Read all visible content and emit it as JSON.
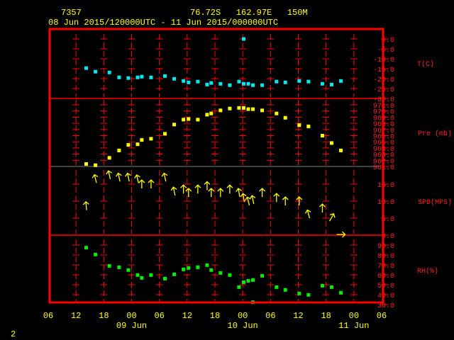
{
  "header": {
    "station_id": "7357",
    "location": "76.72S   162.97E   150M",
    "period": "08 Jun 2015/120000UTC - 11 Jun 2015/000000UTC"
  },
  "page_number": "2",
  "colors": {
    "frame": "#ff0000",
    "text": "#ffff00",
    "temp": "#00e8f0",
    "pressure": "#ffff00",
    "wind": "#ffff00",
    "rh": "#00ee00",
    "divider_gray": "#808080"
  },
  "chart_data": {
    "type": "scatter",
    "x_unit": "hours since 08 Jun 2015 06 UTC",
    "xlim": [
      0,
      72
    ],
    "x_tick_labels": [
      "06",
      "12",
      "18",
      "00",
      "06",
      "12",
      "18",
      "00",
      "06",
      "12",
      "18",
      "00",
      "06"
    ],
    "date_labels": [
      {
        "label": "09 Jun",
        "hour": 18
      },
      {
        "label": "10 Jun",
        "hour": 42
      },
      {
        "label": "11 Jun",
        "hour": 66
      }
    ],
    "times": [
      8.2,
      10.2,
      13.2,
      15.3,
      17.3,
      19.3,
      20.2,
      22.2,
      25.2,
      27.2,
      29.2,
      30.3,
      32.3,
      34.3,
      35.2,
      37.2,
      39.2,
      41.2,
      42.2,
      43.2,
      44.2,
      46.2,
      49.3,
      51.2,
      54.2,
      56.2,
      59.2,
      61.2,
      63.2
    ],
    "panels": [
      {
        "name": "temperature",
        "label": "T(C)",
        "ylim": [
          -30,
          0
        ],
        "tick_labels": [
          "0.0",
          "-5.0",
          "-10.0",
          "-15.0",
          "-20.0",
          "-25.0",
          "-30.0"
        ],
        "tick_values": [
          0,
          -5,
          -10,
          -15,
          -20,
          -25,
          -30
        ],
        "values": [
          -14.7,
          -16.5,
          -16.9,
          -19.4,
          -19.7,
          -19.4,
          -19.0,
          -19.4,
          -18.7,
          -20.1,
          -21.2,
          -21.9,
          -21.5,
          -23.0,
          -22.2,
          -22.6,
          -23.3,
          -21.5,
          -22.6,
          -22.6,
          -23.3,
          -23.3,
          -21.5,
          -21.9,
          -21.2,
          -21.5,
          -22.6,
          -23.0,
          -21.2
        ],
        "extra_points": [
          {
            "time": 42.2,
            "value": 0.0
          }
        ]
      },
      {
        "name": "pressure",
        "label": "Pre (mb)",
        "ylim": [
          961,
          971
        ],
        "tick_labels": [
          "971.0",
          "970.0",
          "969.0",
          "968.0",
          "967.0",
          "966.0",
          "965.0",
          "964.0",
          "963.0",
          "962.0",
          "961.0"
        ],
        "tick_values": [
          971,
          970,
          969,
          968,
          967,
          966,
          965,
          964,
          963,
          962,
          961
        ],
        "values": [
          961.4,
          961.2,
          962.4,
          963.6,
          964.5,
          964.6,
          965.3,
          965.5,
          966.3,
          967.8,
          968.6,
          968.7,
          968.6,
          969.4,
          969.6,
          970.1,
          970.4,
          970.5,
          970.5,
          970.3,
          970.3,
          970.1,
          969.6,
          968.9,
          967.7,
          967.5,
          966.0,
          964.8,
          963.6
        ],
        "extra_points": []
      },
      {
        "name": "wind",
        "label": "SPD(MPS)",
        "ylim": [
          0,
          20
        ],
        "tick_labels": [
          "15.0",
          "10.0",
          "5.0",
          "0.0"
        ],
        "tick_values": [
          15,
          10,
          5,
          0
        ],
        "values": [
          8.6,
          16.6,
          17.7,
          17.0,
          17.0,
          16.5,
          15.0,
          15.0,
          17.0,
          12.9,
          13.5,
          12.5,
          13.5,
          14.5,
          12.5,
          12.5,
          13.5,
          12.5,
          11.0,
          10.0,
          10.4,
          12.5,
          11.0,
          10.0,
          10.0,
          6.2,
          7.9,
          5.2,
          0.2
        ],
        "direction_from_deg": [
          175,
          166,
          167,
          168,
          168,
          168,
          180,
          180,
          168,
          168,
          180,
          180,
          180,
          180,
          180,
          180,
          180,
          170,
          170,
          165,
          168,
          180,
          180,
          180,
          180,
          165,
          180,
          210,
          270
        ],
        "extra_points": []
      },
      {
        "name": "relative-humidity",
        "label": "RH(%)",
        "ylim": [
          30,
          90
        ],
        "tick_labels": [
          "90.0",
          "80.0",
          "70.0",
          "60.0",
          "50.0",
          "40.0",
          "30.0"
        ],
        "tick_values": [
          90,
          80,
          70,
          60,
          50,
          40,
          30
        ],
        "values": [
          87.4,
          80.5,
          69.0,
          67.6,
          64.8,
          59.8,
          56.9,
          59.8,
          56.2,
          60.5,
          65.5,
          66.9,
          67.6,
          69.8,
          64.8,
          61.9,
          59.8,
          47.6,
          52.6,
          54.0,
          54.8,
          59.0,
          47.6,
          44.8,
          41.2,
          39.8,
          49.0,
          47.6,
          41.9
        ],
        "extra_points": [
          {
            "time": 44.2,
            "value": 32.4
          }
        ]
      }
    ]
  }
}
